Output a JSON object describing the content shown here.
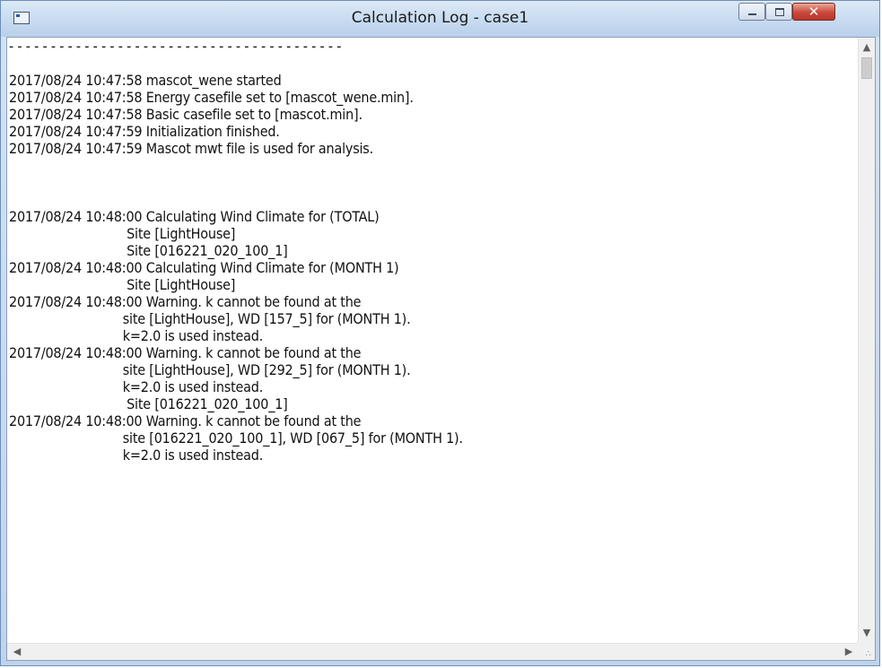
{
  "window": {
    "title": "Calculation Log - case1",
    "close_glyph": "✕"
  },
  "log": {
    "lines": [
      "- - - - - - - - - - - - - - - - - - - - - - - - - - - - - - - - - - - - - - - -",
      "",
      "2017/08/24 10:47:58 mascot_wene started",
      "2017/08/24 10:47:58 Energy casefile set to [mascot_wene.min].",
      "2017/08/24 10:47:58 Basic casefile set to [mascot.min].",
      "2017/08/24 10:47:59 Initialization finished.",
      "2017/08/24 10:47:59 Mascot mwt file is used for analysis.",
      "",
      "",
      "",
      "2017/08/24 10:48:00 Calculating Wind Climate for (TOTAL)",
      "                              Site [LightHouse]",
      "                              Site [016221_020_100_1]",
      "2017/08/24 10:48:00 Calculating Wind Climate for (MONTH 1)",
      "                              Site [LightHouse]",
      "2017/08/24 10:48:00 Warning. k cannot be found at the",
      "                             site [LightHouse], WD [157_5] for (MONTH 1).",
      "                             k=2.0 is used instead.",
      "2017/08/24 10:48:00 Warning. k cannot be found at the",
      "                             site [LightHouse], WD [292_5] for (MONTH 1).",
      "                             k=2.0 is used instead.",
      "                              Site [016221_020_100_1]",
      "2017/08/24 10:48:00 Warning. k cannot be found at the",
      "                             site [016221_020_100_1], WD [067_5] for (MONTH 1).",
      "                             k=2.0 is used instead."
    ]
  },
  "scrollbars": {
    "up_icon": "▲",
    "down_icon": "▼",
    "left_icon": "◀",
    "right_icon": "▶"
  },
  "colors": {
    "titlebar": "#c9dcf1",
    "close_button": "#c9483a",
    "text": "#111111"
  }
}
